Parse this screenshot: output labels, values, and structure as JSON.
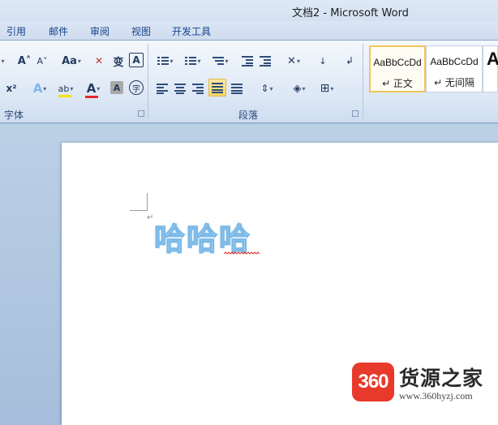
{
  "window": {
    "title": "文档2 - Microsoft Word"
  },
  "tabs": [
    "引用",
    "邮件",
    "审阅",
    "视图",
    "开发工具"
  ],
  "ribbon": {
    "font_group": {
      "label": "字体",
      "grow_font": "A˄",
      "shrink_font": "A˅",
      "change_case": "Aa",
      "clear_formatting": "✕",
      "phonetic_guide": "变",
      "char_border": "A",
      "superscript": "x²",
      "text_effects": "A",
      "highlight": "ab",
      "font_color": "A",
      "char_shading": "A",
      "enclose_char": "字"
    },
    "paragraph_group": {
      "label": "段落"
    },
    "styles": [
      {
        "sample": "AaBbCcDd",
        "name": "↵ 正文"
      },
      {
        "sample": "AaBbCcDd",
        "name": "↵ 无间隔"
      }
    ],
    "styles_more_sample": "A"
  },
  "document": {
    "paragraph_mark": "↵",
    "text": "哈哈哈"
  },
  "watermark": {
    "badge": "360",
    "title": "货源之家",
    "url": "www.360hyzj.com"
  },
  "colors": {
    "accent_highlight": "#f9d867",
    "font_color_bar": "#e5262b",
    "highlight_color_bar": "#f5e11a",
    "text_outline": "#7ab8e6",
    "watermark_red": "#e83a2c"
  }
}
